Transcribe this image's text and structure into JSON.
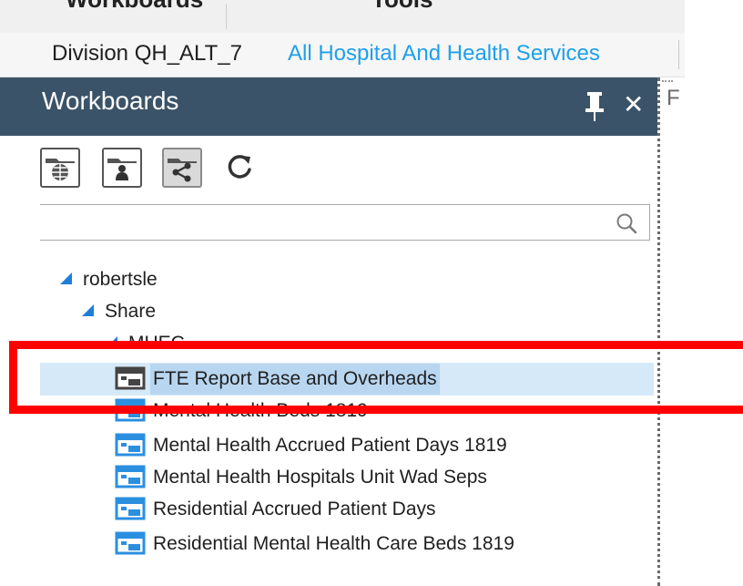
{
  "menubar": {
    "items": [
      {
        "label": "Workboards"
      },
      {
        "label": "Tools"
      }
    ]
  },
  "division": {
    "label": "Division QH_ALT_7",
    "link": "All Hospital And Health Services"
  },
  "panel": {
    "title": "Workboards",
    "right_fragment": "F"
  },
  "toolbar": {
    "buttons": [
      {
        "name": "global-workboards",
        "icon": "globe-folder-icon"
      },
      {
        "name": "personal-workboards",
        "icon": "person-folder-icon"
      },
      {
        "name": "shared-workboards",
        "icon": "share-folder-icon",
        "active": true
      }
    ],
    "refresh_icon": "refresh-icon"
  },
  "search": {
    "value": "",
    "placeholder": ""
  },
  "tree": {
    "root": "robertsle",
    "share": "Share",
    "folder": "MHEC",
    "items": [
      {
        "label": "FTE Report Base and Overheads",
        "selected": true
      },
      {
        "label": "Mental Health Beds 1819"
      },
      {
        "label": "Mental Health  Accrued Patient Days 1819"
      },
      {
        "label": "Mental Health Hospitals Unit Wad Seps"
      },
      {
        "label": "Residential Accrued Patient Days"
      },
      {
        "label": "Residential Mental Health Care Beds 1819"
      }
    ]
  },
  "colors": {
    "panel_header": "#3b5368",
    "link": "#1ea0ea",
    "tree_triangle": "#1f7fd8",
    "selection": "#d6e9f8",
    "annotation": "#ff0000"
  }
}
